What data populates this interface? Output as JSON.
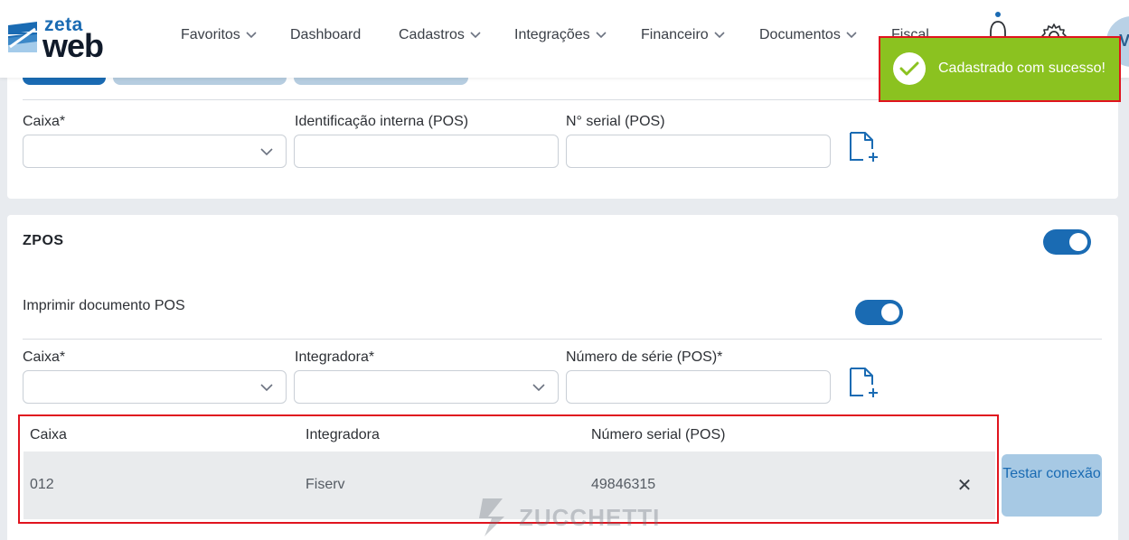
{
  "header": {
    "logo_top": "zeta",
    "logo_bottom": "web",
    "nav": [
      {
        "label": "Favoritos",
        "has_dropdown": true
      },
      {
        "label": "Dashboard",
        "has_dropdown": false
      },
      {
        "label": "Cadastros",
        "has_dropdown": true
      },
      {
        "label": "Integrações",
        "has_dropdown": true
      },
      {
        "label": "Financeiro",
        "has_dropdown": true
      },
      {
        "label": "Documentos",
        "has_dropdown": true
      },
      {
        "label": "Fiscal",
        "has_dropdown": false
      }
    ],
    "avatar_initial": "V",
    "icons": [
      "bell-icon",
      "gear-icon"
    ]
  },
  "toast": {
    "message": "Cadastrado com sucesso!",
    "color": "#8bc220",
    "icon": "check-circle-icon"
  },
  "pos_section": {
    "caixa_label": "Caixa*",
    "caixa_value": "",
    "id_interna_label": "Identificação interna (POS)",
    "id_interna_value": "",
    "serial_label": "N° serial (POS)",
    "serial_value": "",
    "add_icon": "add-document-icon"
  },
  "zpos_section": {
    "title": "ZPOS",
    "enabled": true,
    "print_label": "Imprimir documento POS",
    "print_enabled": true,
    "caixa_label": "Caixa*",
    "caixa_value": "",
    "integradora_label": "Integradora*",
    "integradora_value": "",
    "serie_label": "Número de série (POS)*",
    "serie_value": "",
    "table": {
      "headers": [
        "Caixa",
        "Integradora",
        "Número serial (POS)"
      ],
      "rows": [
        {
          "caixa": "012",
          "integradora": "Fiserv",
          "serial": "49846315"
        }
      ]
    },
    "test_button": "Testar conexão"
  },
  "watermark": "ZUCCHETTI",
  "colors": {
    "primary": "#1a6bb3",
    "success": "#8bc220",
    "highlight_border": "#e0141e",
    "background": "#e8ebef"
  }
}
